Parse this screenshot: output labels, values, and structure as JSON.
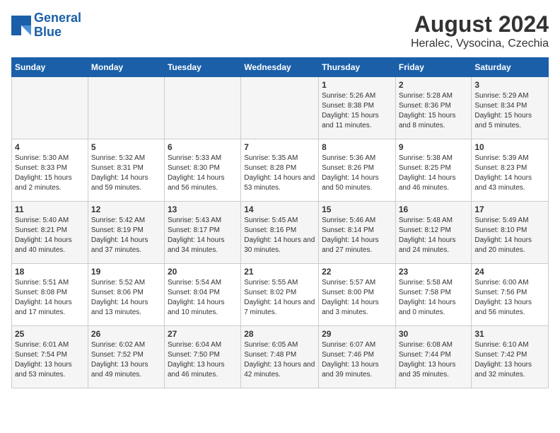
{
  "header": {
    "logo_line1": "General",
    "logo_line2": "Blue",
    "title": "August 2024",
    "subtitle": "Heralec, Vysocina, Czechia"
  },
  "calendar": {
    "weekdays": [
      "Sunday",
      "Monday",
      "Tuesday",
      "Wednesday",
      "Thursday",
      "Friday",
      "Saturday"
    ],
    "weeks": [
      [
        {
          "day": "",
          "info": ""
        },
        {
          "day": "",
          "info": ""
        },
        {
          "day": "",
          "info": ""
        },
        {
          "day": "",
          "info": ""
        },
        {
          "day": "1",
          "info": "Sunrise: 5:26 AM\nSunset: 8:38 PM\nDaylight: 15 hours and 11 minutes."
        },
        {
          "day": "2",
          "info": "Sunrise: 5:28 AM\nSunset: 8:36 PM\nDaylight: 15 hours and 8 minutes."
        },
        {
          "day": "3",
          "info": "Sunrise: 5:29 AM\nSunset: 8:34 PM\nDaylight: 15 hours and 5 minutes."
        }
      ],
      [
        {
          "day": "4",
          "info": "Sunrise: 5:30 AM\nSunset: 8:33 PM\nDaylight: 15 hours and 2 minutes."
        },
        {
          "day": "5",
          "info": "Sunrise: 5:32 AM\nSunset: 8:31 PM\nDaylight: 14 hours and 59 minutes."
        },
        {
          "day": "6",
          "info": "Sunrise: 5:33 AM\nSunset: 8:30 PM\nDaylight: 14 hours and 56 minutes."
        },
        {
          "day": "7",
          "info": "Sunrise: 5:35 AM\nSunset: 8:28 PM\nDaylight: 14 hours and 53 minutes."
        },
        {
          "day": "8",
          "info": "Sunrise: 5:36 AM\nSunset: 8:26 PM\nDaylight: 14 hours and 50 minutes."
        },
        {
          "day": "9",
          "info": "Sunrise: 5:38 AM\nSunset: 8:25 PM\nDaylight: 14 hours and 46 minutes."
        },
        {
          "day": "10",
          "info": "Sunrise: 5:39 AM\nSunset: 8:23 PM\nDaylight: 14 hours and 43 minutes."
        }
      ],
      [
        {
          "day": "11",
          "info": "Sunrise: 5:40 AM\nSunset: 8:21 PM\nDaylight: 14 hours and 40 minutes."
        },
        {
          "day": "12",
          "info": "Sunrise: 5:42 AM\nSunset: 8:19 PM\nDaylight: 14 hours and 37 minutes."
        },
        {
          "day": "13",
          "info": "Sunrise: 5:43 AM\nSunset: 8:17 PM\nDaylight: 14 hours and 34 minutes."
        },
        {
          "day": "14",
          "info": "Sunrise: 5:45 AM\nSunset: 8:16 PM\nDaylight: 14 hours and 30 minutes."
        },
        {
          "day": "15",
          "info": "Sunrise: 5:46 AM\nSunset: 8:14 PM\nDaylight: 14 hours and 27 minutes."
        },
        {
          "day": "16",
          "info": "Sunrise: 5:48 AM\nSunset: 8:12 PM\nDaylight: 14 hours and 24 minutes."
        },
        {
          "day": "17",
          "info": "Sunrise: 5:49 AM\nSunset: 8:10 PM\nDaylight: 14 hours and 20 minutes."
        }
      ],
      [
        {
          "day": "18",
          "info": "Sunrise: 5:51 AM\nSunset: 8:08 PM\nDaylight: 14 hours and 17 minutes."
        },
        {
          "day": "19",
          "info": "Sunrise: 5:52 AM\nSunset: 8:06 PM\nDaylight: 14 hours and 13 minutes."
        },
        {
          "day": "20",
          "info": "Sunrise: 5:54 AM\nSunset: 8:04 PM\nDaylight: 14 hours and 10 minutes."
        },
        {
          "day": "21",
          "info": "Sunrise: 5:55 AM\nSunset: 8:02 PM\nDaylight: 14 hours and 7 minutes."
        },
        {
          "day": "22",
          "info": "Sunrise: 5:57 AM\nSunset: 8:00 PM\nDaylight: 14 hours and 3 minutes."
        },
        {
          "day": "23",
          "info": "Sunrise: 5:58 AM\nSunset: 7:58 PM\nDaylight: 14 hours and 0 minutes."
        },
        {
          "day": "24",
          "info": "Sunrise: 6:00 AM\nSunset: 7:56 PM\nDaylight: 13 hours and 56 minutes."
        }
      ],
      [
        {
          "day": "25",
          "info": "Sunrise: 6:01 AM\nSunset: 7:54 PM\nDaylight: 13 hours and 53 minutes."
        },
        {
          "day": "26",
          "info": "Sunrise: 6:02 AM\nSunset: 7:52 PM\nDaylight: 13 hours and 49 minutes."
        },
        {
          "day": "27",
          "info": "Sunrise: 6:04 AM\nSunset: 7:50 PM\nDaylight: 13 hours and 46 minutes."
        },
        {
          "day": "28",
          "info": "Sunrise: 6:05 AM\nSunset: 7:48 PM\nDaylight: 13 hours and 42 minutes."
        },
        {
          "day": "29",
          "info": "Sunrise: 6:07 AM\nSunset: 7:46 PM\nDaylight: 13 hours and 39 minutes."
        },
        {
          "day": "30",
          "info": "Sunrise: 6:08 AM\nSunset: 7:44 PM\nDaylight: 13 hours and 35 minutes."
        },
        {
          "day": "31",
          "info": "Sunrise: 6:10 AM\nSunset: 7:42 PM\nDaylight: 13 hours and 32 minutes."
        }
      ]
    ]
  }
}
